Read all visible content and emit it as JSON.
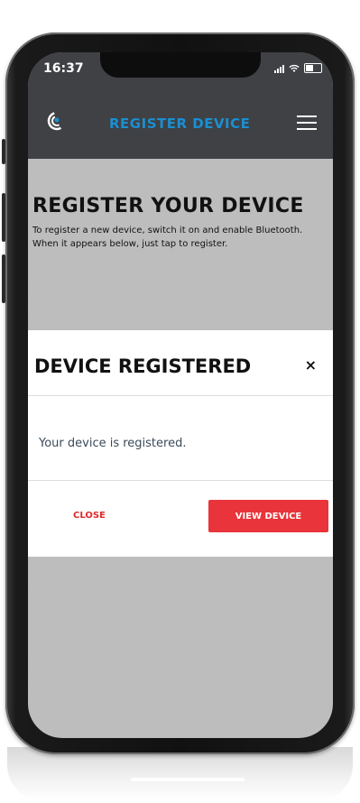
{
  "status": {
    "time": "16:37"
  },
  "header": {
    "title": "REGISTER DEVICE",
    "logo": "brand-logo-icon",
    "menu": "hamburger-menu-icon"
  },
  "page": {
    "heading": "REGISTER YOUR DEVICE",
    "description": "To register a new device, switch it on and enable Bluetooth. When it appears below, just tap to register."
  },
  "modal": {
    "title": "DEVICE REGISTERED",
    "close_icon": "×",
    "message": "Your device is registered.",
    "close_label": "CLOSE",
    "view_label": "VIEW DEVICE"
  },
  "colors": {
    "accent": "#1a8fd1",
    "danger": "#e8343a",
    "header_bg": "#3f4145",
    "overlay_bg": "#bdbdbd"
  }
}
